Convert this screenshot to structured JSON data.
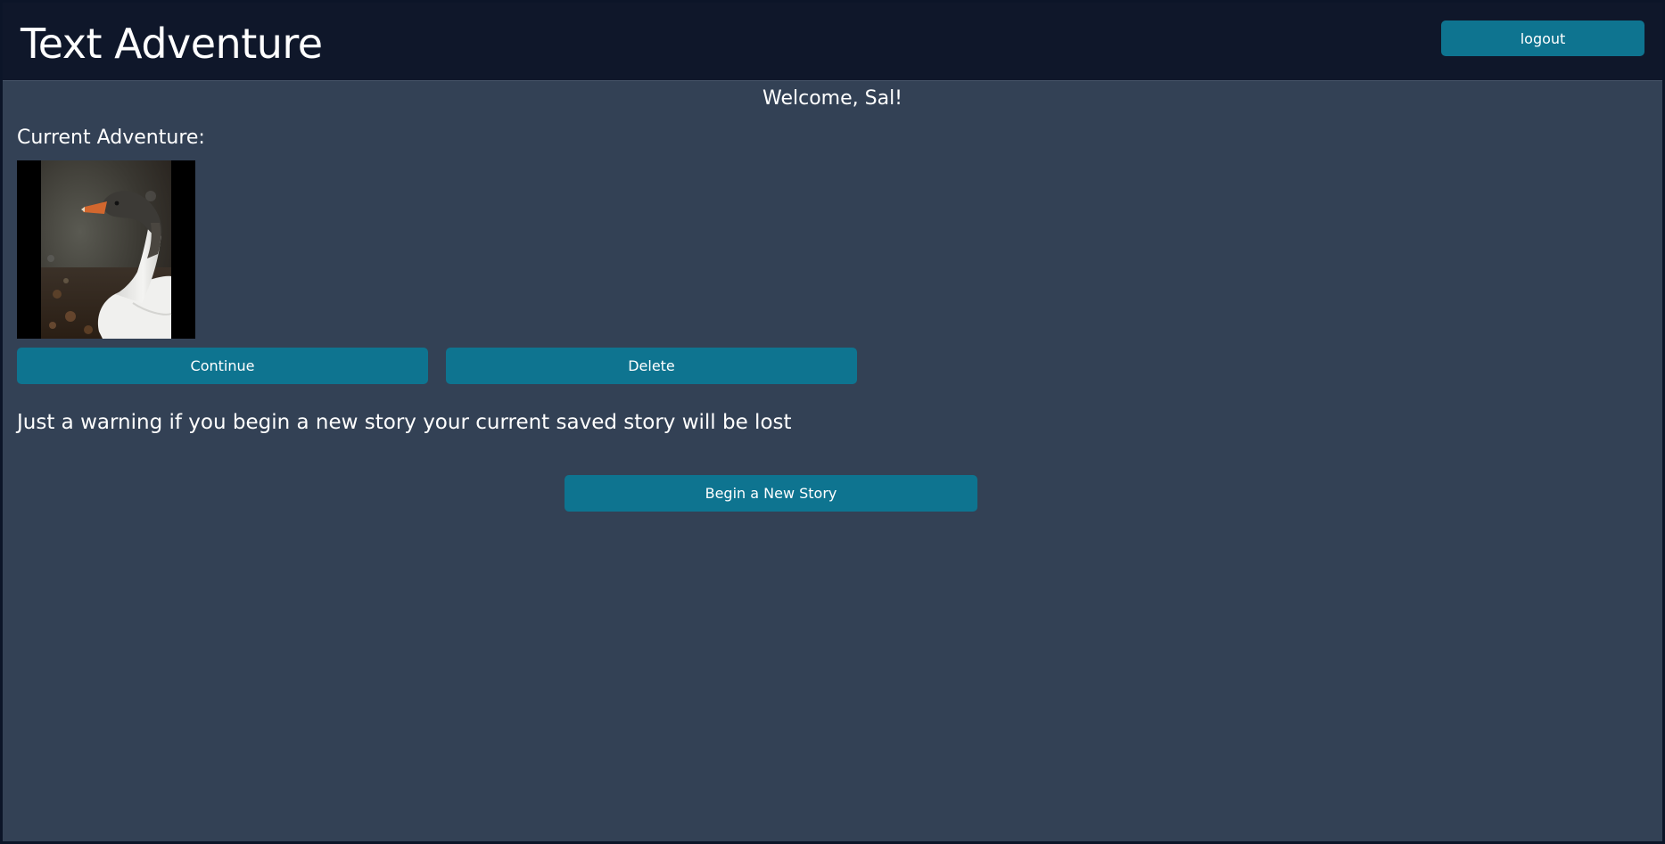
{
  "header": {
    "title": "Text Adventure",
    "logout_label": "logout"
  },
  "main": {
    "welcome": "Welcome, Sal!",
    "current_label": "Current Adventure:",
    "adventure_image": "goose-photo",
    "continue_label": "Continue",
    "delete_label": "Delete",
    "warning": "Just a warning if you begin a new story your current saved story will be lost",
    "new_story_label": "Begin a New Story"
  },
  "colors": {
    "header_bg": "#0f172a",
    "page_bg": "#334155",
    "button_bg": "#0e7490",
    "text": "#ffffff"
  }
}
